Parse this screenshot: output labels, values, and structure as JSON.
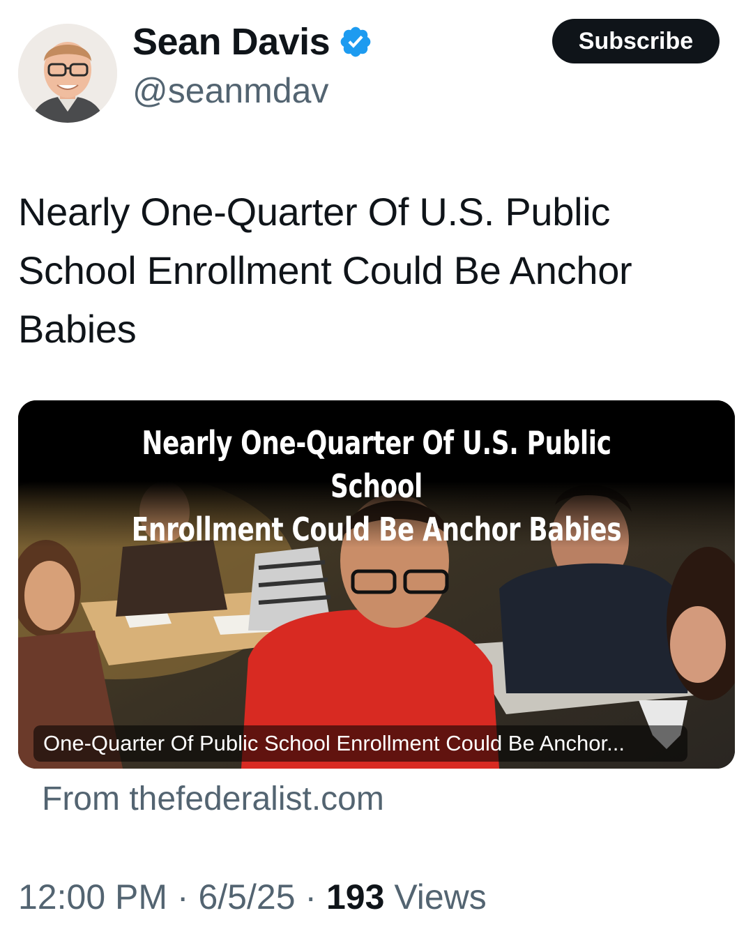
{
  "author": {
    "display_name": "Sean Davis",
    "handle": "@seanmdav",
    "verified_icon": "verified-badge-icon",
    "avatar_icon": "profile-photo"
  },
  "subscribe_label": "Subscribe",
  "tweet": {
    "text": "Nearly One-Quarter Of U.S. Public School Enrollment Could Be Anchor Babies"
  },
  "card": {
    "headline_line1": "Nearly One-Quarter Of U.S. Public School",
    "headline_line2": "Enrollment Could Be Anchor Babies",
    "caption": "One-Quarter Of Public School Enrollment Could Be Anchor...",
    "source": "From thefederalist.com"
  },
  "meta": {
    "time": "12:00 PM",
    "separator": "·",
    "date": "6/5/25",
    "views_count": "193",
    "views_label": "Views"
  },
  "colors": {
    "accent_blue": "#1d9bf0",
    "text_primary": "#0f1419",
    "text_secondary": "#536471",
    "button_bg": "#0f1419"
  }
}
